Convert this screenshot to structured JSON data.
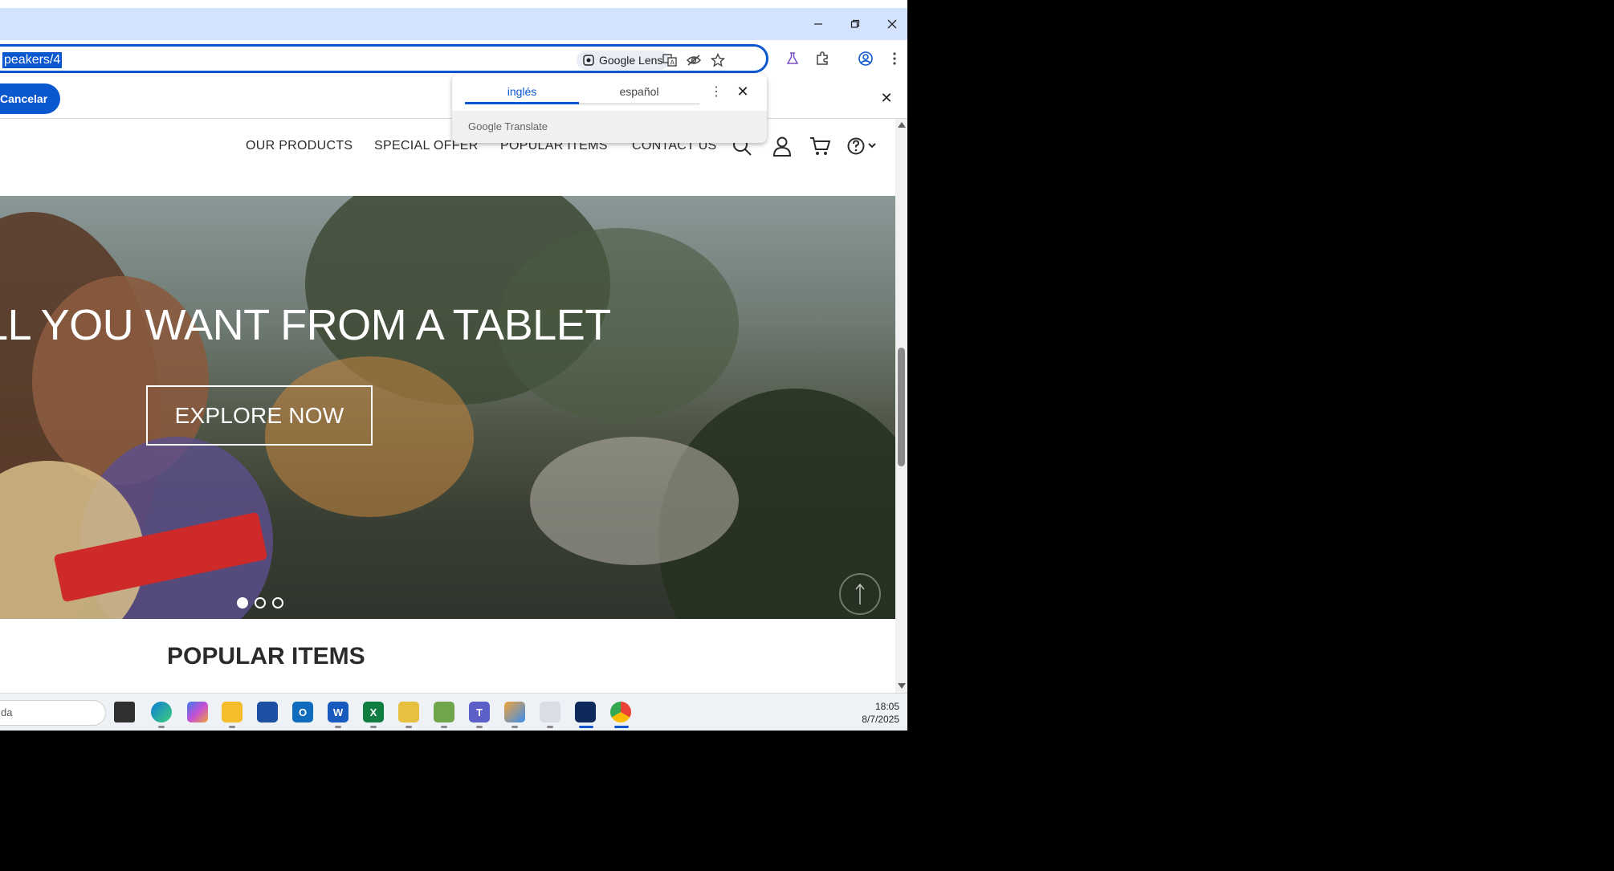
{
  "browser": {
    "url_selected": "peakers/4",
    "lens_label": "Google Lens",
    "window_controls": [
      "minimize-icon",
      "restore-icon",
      "close-icon"
    ]
  },
  "translate_bar": {
    "cancel_label": "Cancelar"
  },
  "translate_popup": {
    "source_lang": "inglés",
    "target_lang": "español",
    "brand": "Google Translate"
  },
  "site": {
    "nav": [
      "OUR PRODUCTS",
      "SPECIAL OFFER",
      "POPULAR ITEMS",
      "CONTACT US"
    ],
    "hero_title": "LL YOU WANT FROM A TABLET",
    "hero_button": "EXPLORE NOW",
    "carousel_dots": 3,
    "active_dot": 1,
    "section_title": "POPULAR ITEMS"
  },
  "taskbar": {
    "search_text": "da",
    "time": "18:05",
    "date": "8/7/2025"
  },
  "colors": {
    "accent": "#0b57d0",
    "titlebar": "#d3e3fd"
  }
}
